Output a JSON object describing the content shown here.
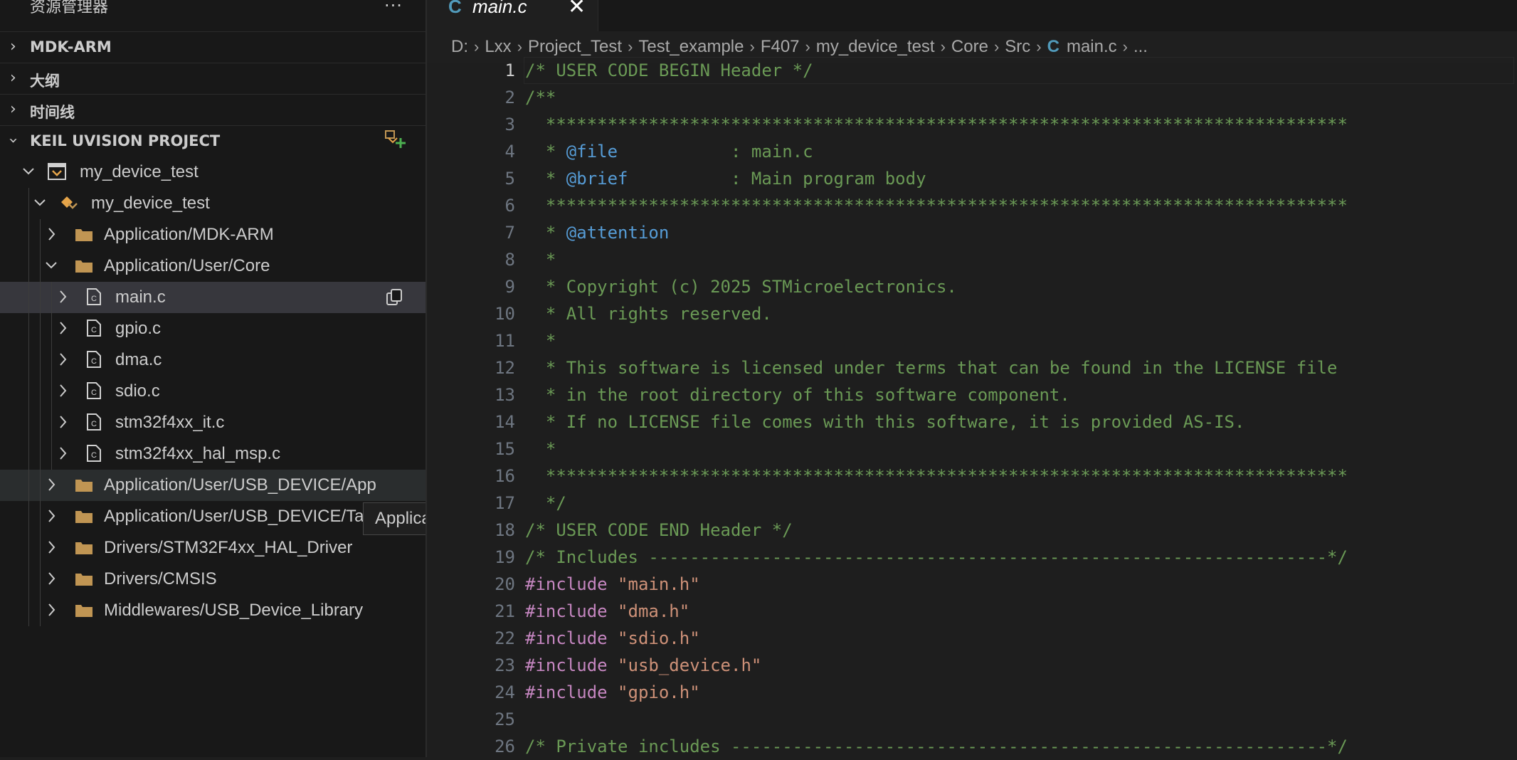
{
  "sidebar": {
    "title": "资源管理器",
    "more_label": "···",
    "sections": [
      {
        "label": "MDK-ARM",
        "expanded": false
      },
      {
        "label": "大纲",
        "expanded": false
      },
      {
        "label": "时间线",
        "expanded": false
      },
      {
        "label": "KEIL UVISION PROJECT",
        "expanded": true
      }
    ],
    "tree": [
      {
        "label": "my_device_test",
        "type": "project",
        "expanded": true,
        "level": 0
      },
      {
        "label": "my_device_test",
        "type": "target",
        "expanded": true,
        "level": 1
      },
      {
        "label": "Application/MDK-ARM",
        "type": "folder",
        "expanded": false,
        "level": 2
      },
      {
        "label": "Application/User/Core",
        "type": "folder",
        "expanded": true,
        "level": 2
      },
      {
        "label": "main.c",
        "type": "file",
        "expanded": false,
        "level": 3,
        "selected": true
      },
      {
        "label": "gpio.c",
        "type": "file",
        "expanded": false,
        "level": 3
      },
      {
        "label": "dma.c",
        "type": "file",
        "expanded": false,
        "level": 3
      },
      {
        "label": "sdio.c",
        "type": "file",
        "expanded": false,
        "level": 3
      },
      {
        "label": "stm32f4xx_it.c",
        "type": "file",
        "expanded": false,
        "level": 3
      },
      {
        "label": "stm32f4xx_hal_msp.c",
        "type": "file",
        "expanded": false,
        "level": 3
      },
      {
        "label": "Application/User/USB_DEVICE/App",
        "type": "folder",
        "expanded": false,
        "level": 2,
        "hover": true
      },
      {
        "label": "Application/User/USB_DEVICE/Target",
        "type": "folder",
        "expanded": false,
        "level": 2
      },
      {
        "label": "Drivers/STM32F4xx_HAL_Driver",
        "type": "folder",
        "expanded": false,
        "level": 2
      },
      {
        "label": "Drivers/CMSIS",
        "type": "folder",
        "expanded": false,
        "level": 2
      },
      {
        "label": "Middlewares/USB_Device_Library",
        "type": "folder",
        "expanded": false,
        "level": 2
      }
    ],
    "tooltip": "Application/User/USB_DEVICE/App"
  },
  "editor": {
    "tab": {
      "icon": "C",
      "label": "main.c",
      "close": "✕"
    },
    "breadcrumbs": [
      "D:",
      "Lxx",
      "Project_Test",
      "Test_example",
      "F407",
      "my_device_test",
      "Core",
      "Src",
      "main.c",
      "..."
    ],
    "breadcrumb_file_icon": "C",
    "active_line": 1,
    "lines": [
      {
        "n": "1",
        "tokens": [
          {
            "t": "/* USER CODE BEGIN Header */",
            "c": "cm"
          }
        ]
      },
      {
        "n": "2",
        "tokens": [
          {
            "t": "/**",
            "c": "cm"
          }
        ]
      },
      {
        "n": "3",
        "tokens": [
          {
            "t": "  ******************************************************************************",
            "c": "cm"
          }
        ]
      },
      {
        "n": "4",
        "tokens": [
          {
            "t": "  * ",
            "c": "cm"
          },
          {
            "t": "@file",
            "c": "kw-tag"
          },
          {
            "t": "           : main.c",
            "c": "cm"
          }
        ]
      },
      {
        "n": "5",
        "tokens": [
          {
            "t": "  * ",
            "c": "cm"
          },
          {
            "t": "@brief",
            "c": "kw-tag"
          },
          {
            "t": "          : Main program body",
            "c": "cm"
          }
        ]
      },
      {
        "n": "6",
        "tokens": [
          {
            "t": "  ******************************************************************************",
            "c": "cm"
          }
        ]
      },
      {
        "n": "7",
        "tokens": [
          {
            "t": "  * ",
            "c": "cm"
          },
          {
            "t": "@attention",
            "c": "kw-tag"
          }
        ]
      },
      {
        "n": "8",
        "tokens": [
          {
            "t": "  *",
            "c": "cm"
          }
        ]
      },
      {
        "n": "9",
        "tokens": [
          {
            "t": "  * Copyright (c) 2025 STMicroelectronics.",
            "c": "cm"
          }
        ]
      },
      {
        "n": "10",
        "tokens": [
          {
            "t": "  * All rights reserved.",
            "c": "cm"
          }
        ]
      },
      {
        "n": "11",
        "tokens": [
          {
            "t": "  *",
            "c": "cm"
          }
        ]
      },
      {
        "n": "12",
        "tokens": [
          {
            "t": "  * This software is licensed under terms that can be found in the LICENSE file",
            "c": "cm"
          }
        ]
      },
      {
        "n": "13",
        "tokens": [
          {
            "t": "  * in the root directory of this software component.",
            "c": "cm"
          }
        ]
      },
      {
        "n": "14",
        "tokens": [
          {
            "t": "  * If no LICENSE file comes with this software, it is provided AS-IS.",
            "c": "cm"
          }
        ]
      },
      {
        "n": "15",
        "tokens": [
          {
            "t": "  *",
            "c": "cm"
          }
        ]
      },
      {
        "n": "16",
        "tokens": [
          {
            "t": "  ******************************************************************************",
            "c": "cm"
          }
        ]
      },
      {
        "n": "17",
        "tokens": [
          {
            "t": "  */",
            "c": "cm"
          }
        ]
      },
      {
        "n": "18",
        "tokens": [
          {
            "t": "/* USER CODE END Header */",
            "c": "cm"
          }
        ]
      },
      {
        "n": "19",
        "tokens": [
          {
            "t": "/* Includes ------------------------------------------------------------------*/",
            "c": "cm"
          }
        ]
      },
      {
        "n": "20",
        "tokens": [
          {
            "t": "#include ",
            "c": "pp"
          },
          {
            "t": "\"main.h\"",
            "c": "str"
          }
        ]
      },
      {
        "n": "21",
        "tokens": [
          {
            "t": "#include ",
            "c": "pp"
          },
          {
            "t": "\"dma.h\"",
            "c": "str"
          }
        ]
      },
      {
        "n": "22",
        "tokens": [
          {
            "t": "#include ",
            "c": "pp"
          },
          {
            "t": "\"sdio.h\"",
            "c": "str"
          }
        ]
      },
      {
        "n": "23",
        "tokens": [
          {
            "t": "#include ",
            "c": "pp"
          },
          {
            "t": "\"usb_device.h\"",
            "c": "str"
          }
        ]
      },
      {
        "n": "24",
        "tokens": [
          {
            "t": "#include ",
            "c": "pp"
          },
          {
            "t": "\"gpio.h\"",
            "c": "str"
          }
        ]
      },
      {
        "n": "25",
        "tokens": []
      },
      {
        "n": "26",
        "tokens": [
          {
            "t": "/* Private includes ----------------------------------------------------------*/",
            "c": "cm"
          }
        ]
      }
    ]
  },
  "colors": {
    "comment": "#6a9955",
    "doc_tag": "#569cd6",
    "preprocessor": "#c586c0",
    "string": "#ce9178",
    "c_icon": "#519aba",
    "folder": "#c09553"
  }
}
